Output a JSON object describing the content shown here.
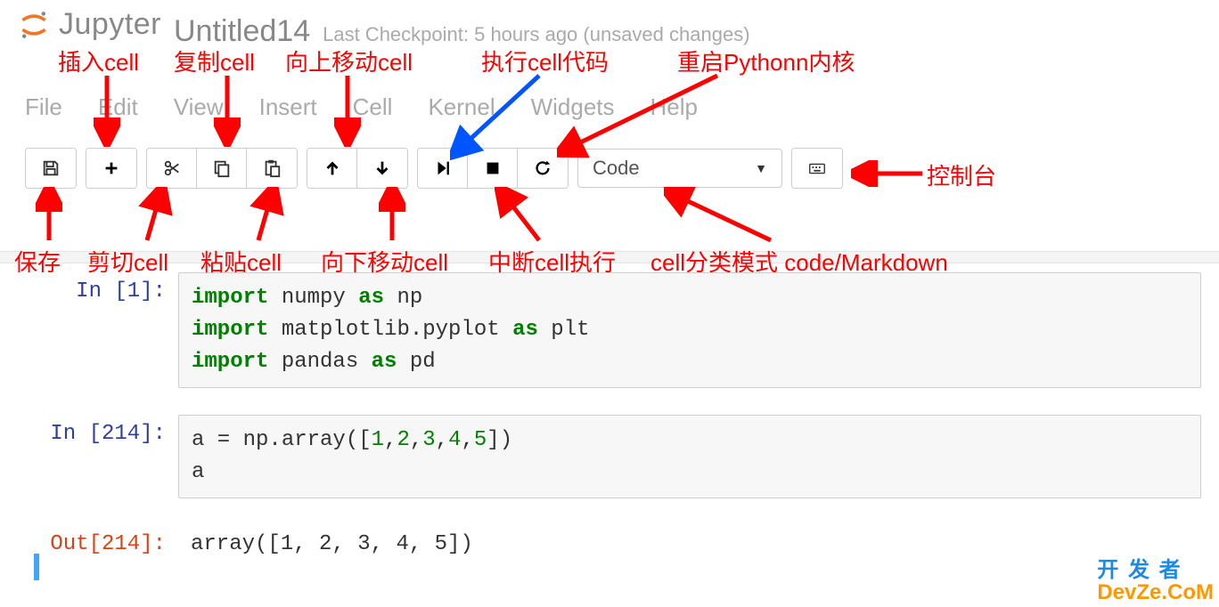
{
  "header": {
    "brand": "Jupyter",
    "title": "Untitled14",
    "checkpoint": "Last Checkpoint: 5 hours ago (unsaved changes)"
  },
  "annotations": {
    "insert_cell": "插入cell",
    "copy_cell": "复制cell",
    "move_up": "向上移动cell",
    "run_cell": "执行cell代码",
    "restart_kernel": "重启Pythonn内核",
    "save": "保存",
    "cut_cell": "剪切cell",
    "paste_cell": "粘贴cell",
    "move_down": "向下移动cell",
    "interrupt": "中断cell执行",
    "cell_type_mode": "cell分类模式 code/Markdown",
    "console": "控制台"
  },
  "menu": {
    "file": "File",
    "edit": "Edit",
    "view": "View",
    "insert": "Insert",
    "cell": "Cell",
    "kernel": "Kernel",
    "widgets": "Widgets",
    "help": "Help"
  },
  "toolbar": {
    "cell_type_value": "Code"
  },
  "cells": [
    {
      "prompt_label": "In ",
      "prompt_num": "[1]:",
      "lines": [
        {
          "raw": "import numpy as np"
        },
        {
          "raw": "import matplotlib.pyplot as plt"
        },
        {
          "raw": "import pandas as pd"
        }
      ]
    },
    {
      "prompt_label": "In ",
      "prompt_num": "[214]:",
      "lines": [
        {
          "raw": "a = np.array([1,2,3,4,5])"
        },
        {
          "raw": "a"
        }
      ],
      "out_label": "Out",
      "out_num": "[214]:",
      "output": "array([1, 2, 3, 4, 5])"
    }
  ],
  "watermark": {
    "l1": "开 发 者",
    "l2": "DevZe.CoM"
  }
}
